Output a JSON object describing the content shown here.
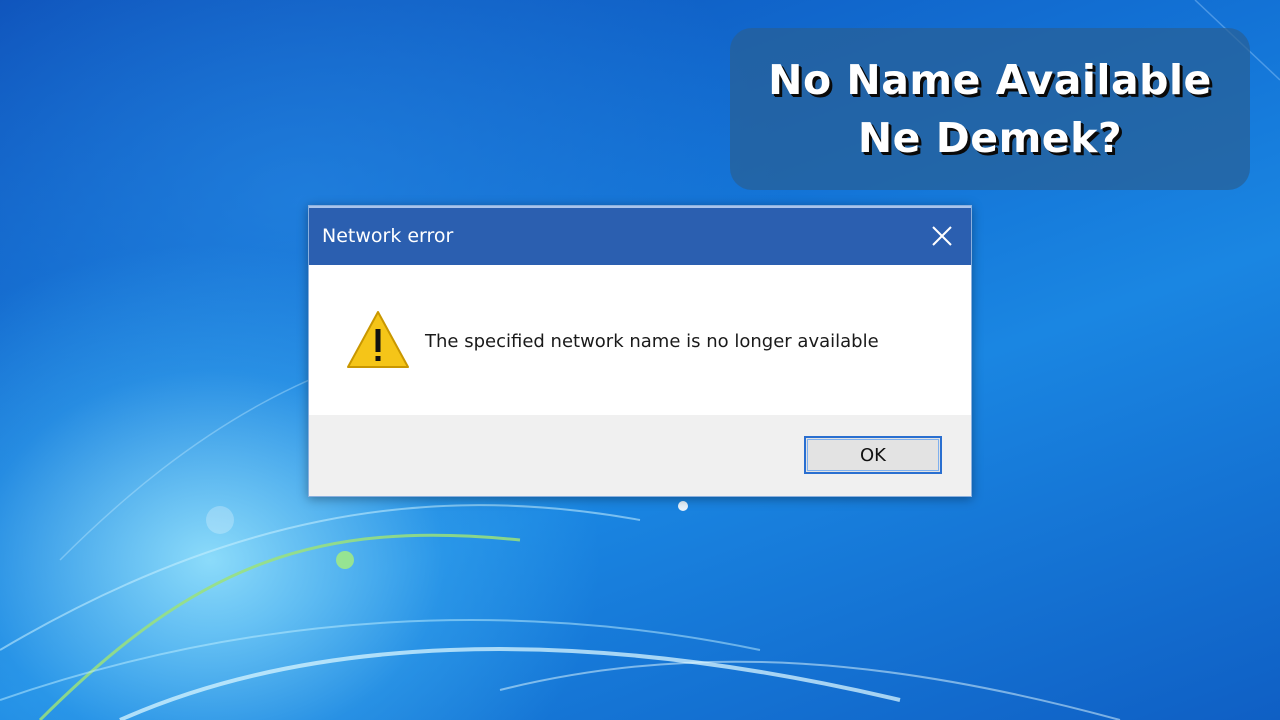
{
  "headline": {
    "line1": "No Name Available",
    "line2": "Ne Demek?"
  },
  "dialog": {
    "title": "Network error",
    "close_icon": "close-icon",
    "warning_icon": "warning-triangle-icon",
    "message": "The specified network name is no longer available",
    "ok_label": "OK"
  },
  "colors": {
    "titlebar": "#2b5fb0",
    "ok_border": "#2a6fd0",
    "warning_fill": "#f5c518"
  }
}
